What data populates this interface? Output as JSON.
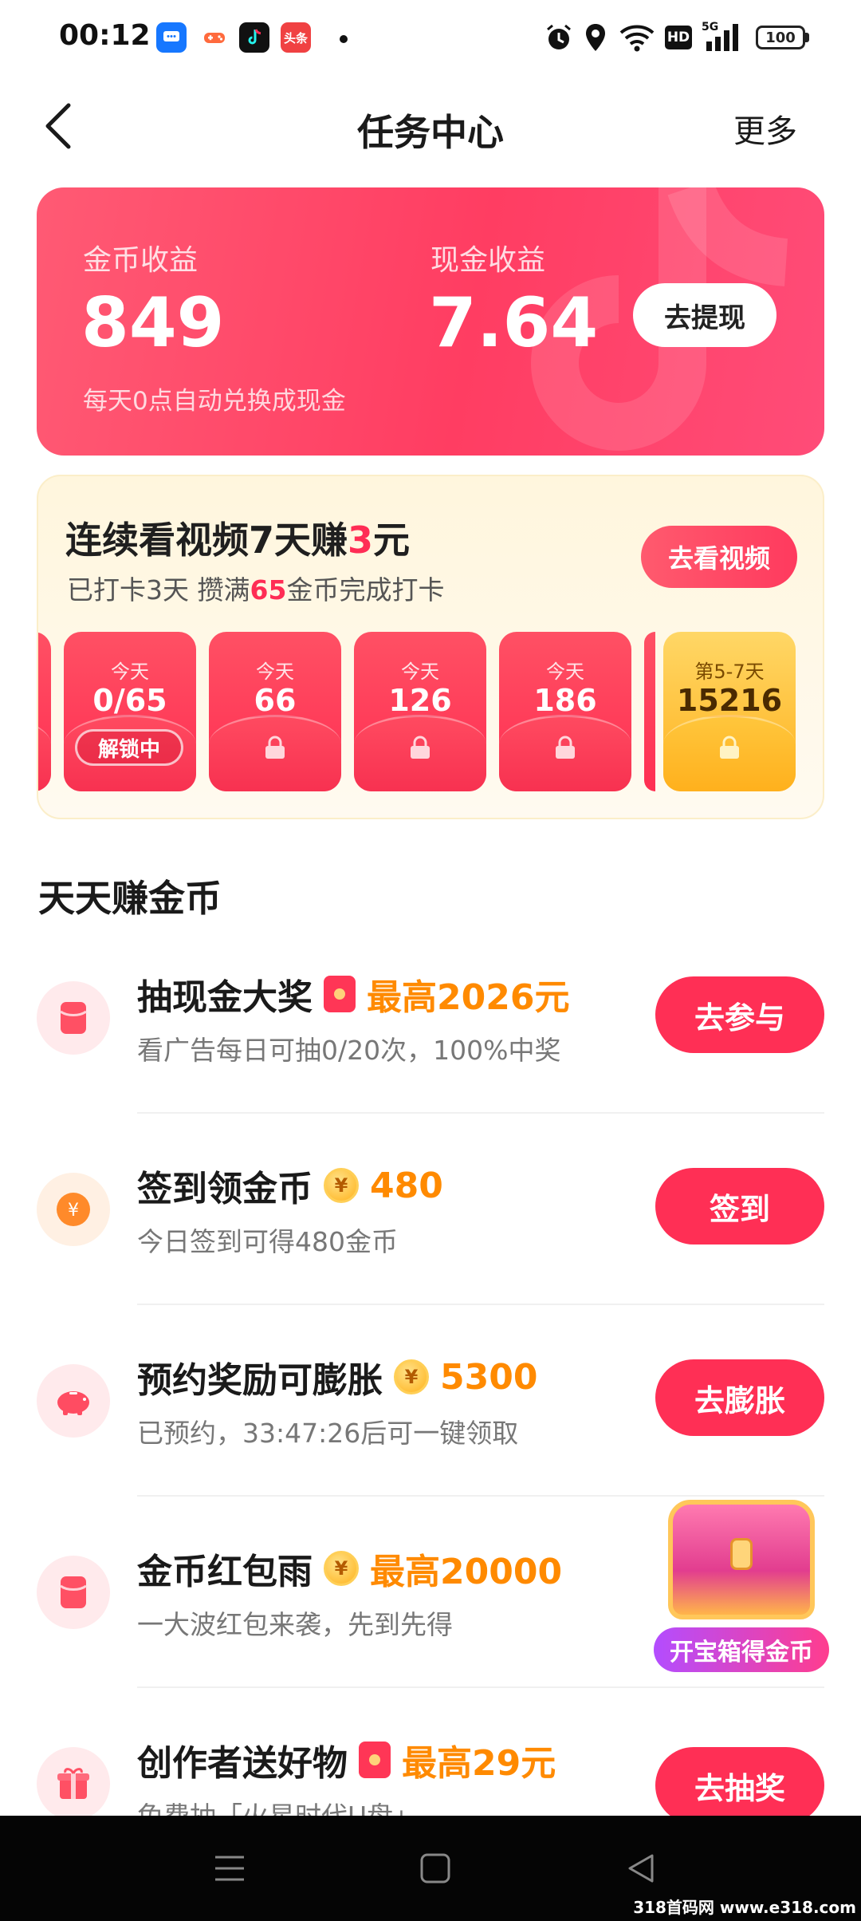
{
  "status_bar": {
    "time": "00:12",
    "app_icons": [
      "message-icon",
      "game-icon",
      "tiktok-icon",
      "toutiao-icon"
    ],
    "toutiao_label": "头条",
    "hd_label": "HD",
    "net_label": "5G",
    "battery": "100"
  },
  "header": {
    "title": "任务中心",
    "more": "更多"
  },
  "earnings": {
    "coin_label": "金币收益",
    "coin_value": "849",
    "cash_label": "现金收益",
    "cash_value": "7.64",
    "note": "每天0点自动兑换成现金",
    "withdraw": "去提现"
  },
  "streak": {
    "title_pre": "连续看视频7天赚",
    "title_num": "3",
    "title_post": "元",
    "sub_pre": "已打卡3天 攒满",
    "sub_num": "65",
    "sub_post": "金币完成打卡",
    "button": "去看视频",
    "days": [
      {
        "label": "今天",
        "value": "0/65",
        "badge": "解锁中"
      },
      {
        "label": "今天",
        "value": "66"
      },
      {
        "label": "今天",
        "value": "126"
      },
      {
        "label": "今天",
        "value": "186"
      },
      {
        "label": "第5-7天",
        "value": "15216"
      }
    ]
  },
  "section_title": "天天赚金币",
  "tasks": [
    {
      "name": "抽现金大奖",
      "reward": "最高2026元",
      "desc": "看广告每日可抽0/20次，100%中奖",
      "button": "去参与"
    },
    {
      "name": "签到领金币",
      "reward": "480",
      "desc": "今日签到可得480金币",
      "button": "签到"
    },
    {
      "name": "预约奖励可膨胀",
      "reward": "5300",
      "desc": "已预约，33:47:26后可一键领取",
      "button": "去膨胀"
    },
    {
      "name": "金币红包雨",
      "reward": "最高20000",
      "desc": "一大波红包来袭，先到先得",
      "button": ""
    },
    {
      "name": "创作者送好物",
      "reward": "最高29元",
      "desc": "免费抽「火星时代U盘」",
      "button": "去抽奖"
    }
  ],
  "coin_symbol": "¥",
  "treasure_label": "开宝箱得金币",
  "watermark": "318首码网 www.e318.com",
  "colors": {
    "accent": "#ff2f55",
    "reward": "#ff8a00",
    "gold": "#ffb21e"
  }
}
